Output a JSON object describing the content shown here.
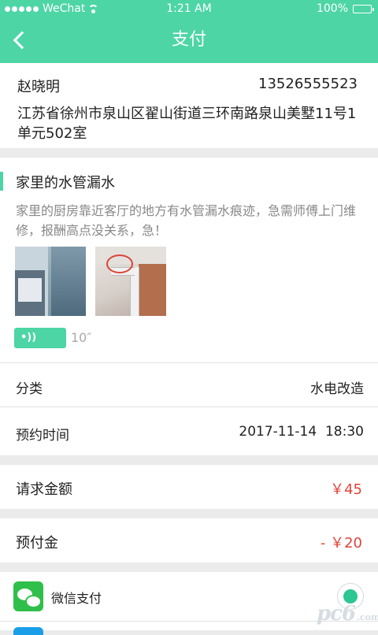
{
  "status_bar": {
    "carrier": "WeChat",
    "time": "1:21 AM",
    "battery": "100%",
    "battery_level": 1.0
  },
  "nav": {
    "title": "支付",
    "back_icon": "chevron-left-icon"
  },
  "address": {
    "name": "赵晓明",
    "phone": "13526555523",
    "detail": "江苏省徐州市泉山区翟山街道三环南路泉山美墅11号1单元502室"
  },
  "order": {
    "title": "家里的水管漏水",
    "description": "家里的厨房靠近客厅的地方有水管漏水痕迹，急需师傅上门维修，报酬高点没关系，急！",
    "voice_duration": "10″",
    "category_label": "分类",
    "category_value": "水电改造",
    "time_label": "预约时间",
    "time_value": "2017-11-14  18:30"
  },
  "amount": {
    "label": "请求金额",
    "value": "￥45"
  },
  "deposit": {
    "label": "预付金",
    "value": "- ￥20"
  },
  "payment": {
    "wechat_label": "微信支付",
    "selected": true
  },
  "watermark": {
    "text": "pc6",
    "sub": ".com"
  },
  "colors": {
    "accent": "#4dd5a6",
    "price_red": "#e0443a",
    "wechat_green": "#2fbf4a"
  }
}
